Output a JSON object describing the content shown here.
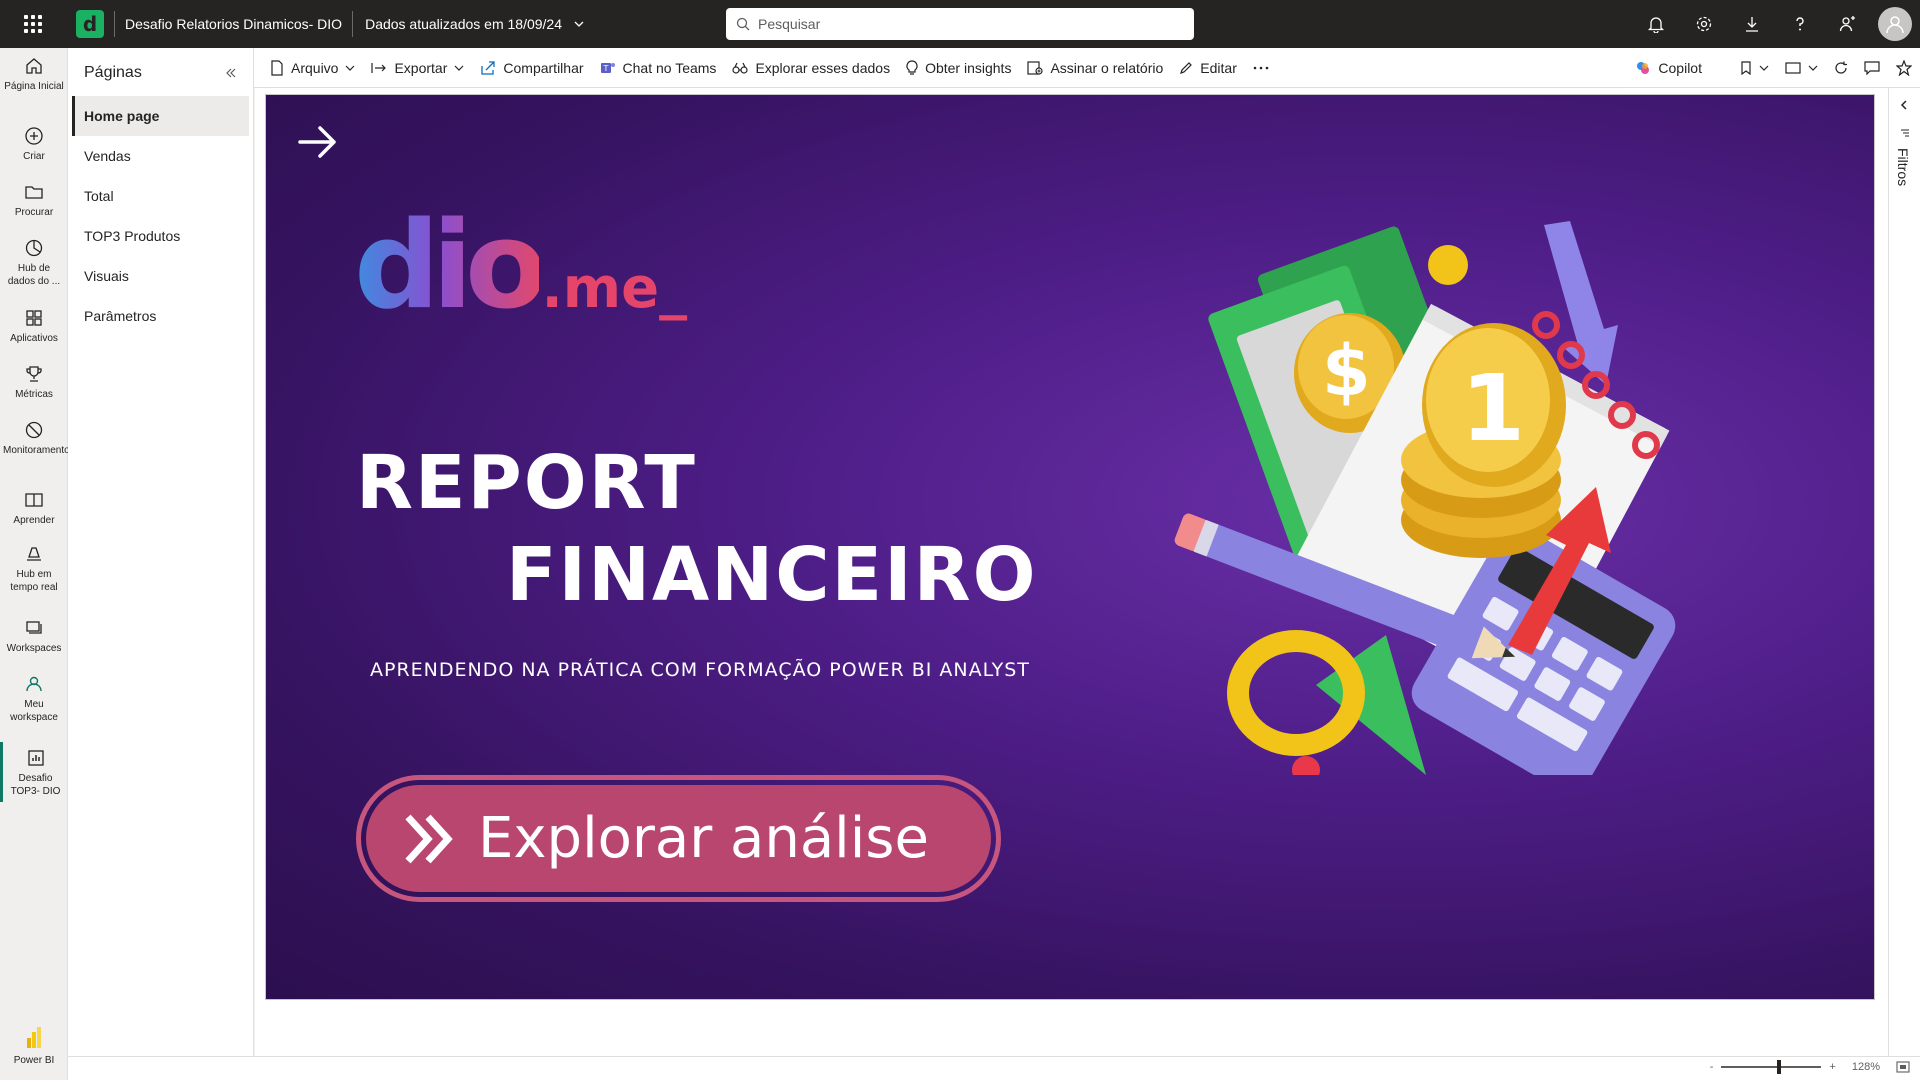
{
  "topbar": {
    "report_title": "Desafio Relatorios Dinamicos- DIO",
    "updated_text": "Dados atualizados em 18/09/24",
    "search_placeholder": "Pesquisar",
    "app_logo_letter": "d"
  },
  "leftnav": {
    "items": [
      {
        "label": "Página Inicial",
        "icon": "home-icon"
      },
      {
        "label": "Criar",
        "icon": "plus-circle-icon"
      },
      {
        "label": "Procurar",
        "icon": "folder-icon"
      },
      {
        "label": "Hub de dados do ...",
        "icon": "data-hub-icon"
      },
      {
        "label": "Aplicativos",
        "icon": "apps-icon"
      },
      {
        "label": "Métricas",
        "icon": "trophy-icon"
      },
      {
        "label": "Monitoramento",
        "icon": "monitor-icon"
      },
      {
        "label": "Aprender",
        "icon": "book-icon"
      },
      {
        "label": "Hub em tempo real",
        "icon": "realtime-icon"
      },
      {
        "label": "Workspaces",
        "icon": "workspaces-icon"
      },
      {
        "label": "Meu workspace",
        "icon": "person-icon"
      },
      {
        "label": "Desafio TOP3- DIO",
        "icon": "report-icon"
      }
    ],
    "footer_label": "Power BI"
  },
  "pages_pane": {
    "title": "Páginas",
    "pages": [
      "Home page",
      "Vendas",
      "Total",
      "TOP3 Produtos",
      "Visuais",
      "Parâmetros"
    ],
    "active_index": 0
  },
  "toolbar": {
    "arquivo": "Arquivo",
    "exportar": "Exportar",
    "compartilhar": "Compartilhar",
    "chat_teams": "Chat no Teams",
    "explorar": "Explorar esses dados",
    "insights": "Obter insights",
    "assinar": "Assinar o relatório",
    "editar": "Editar",
    "copilot": "Copilot"
  },
  "filters": {
    "label": "Filtros"
  },
  "report": {
    "logo_main": "dio",
    "logo_suffix": ".me_",
    "title_line1": "REPORT",
    "title_line2": "FINANCEIRO",
    "subtitle": "APRENDENDO NA PRÁTICA  COM FORMAÇÃO POWER BI ANALYST",
    "cta_label": "Explorar análise",
    "background_color": "#4d1d86",
    "cta_color": "#b8466f"
  },
  "statusbar": {
    "zoom_value": "128%",
    "zoom_minus": "-",
    "zoom_plus": "+"
  }
}
